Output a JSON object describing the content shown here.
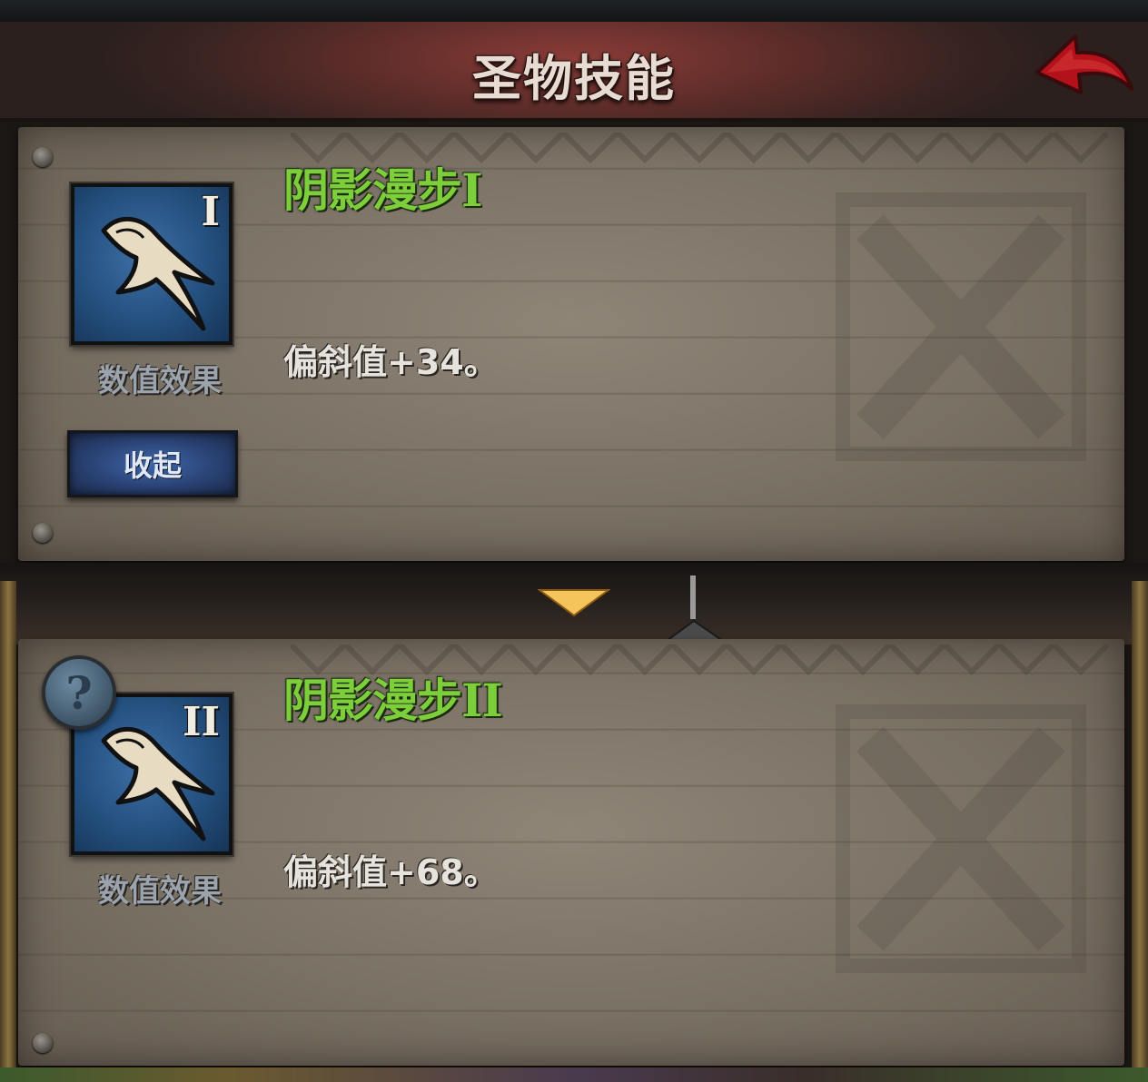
{
  "header": {
    "title": "圣物技能",
    "back_icon": "back-arrow-icon",
    "accent_color": "#b3121a"
  },
  "skills": [
    {
      "name": "阴影漫步I",
      "tier": "I",
      "icon": "claw-skill-icon",
      "effect_type": "数值效果",
      "description": "偏斜值+34。",
      "button_label": "收起"
    },
    {
      "name": "阴影漫步II",
      "tier": "II",
      "icon": "claw-skill-icon",
      "effect_type": "数值效果",
      "description": "偏斜值+68。",
      "help_label": "?"
    }
  ],
  "colors": {
    "skill_name": "#7ccf3a",
    "icon_bg": "#24507f",
    "toggle_arrow": "#f5c45a"
  }
}
